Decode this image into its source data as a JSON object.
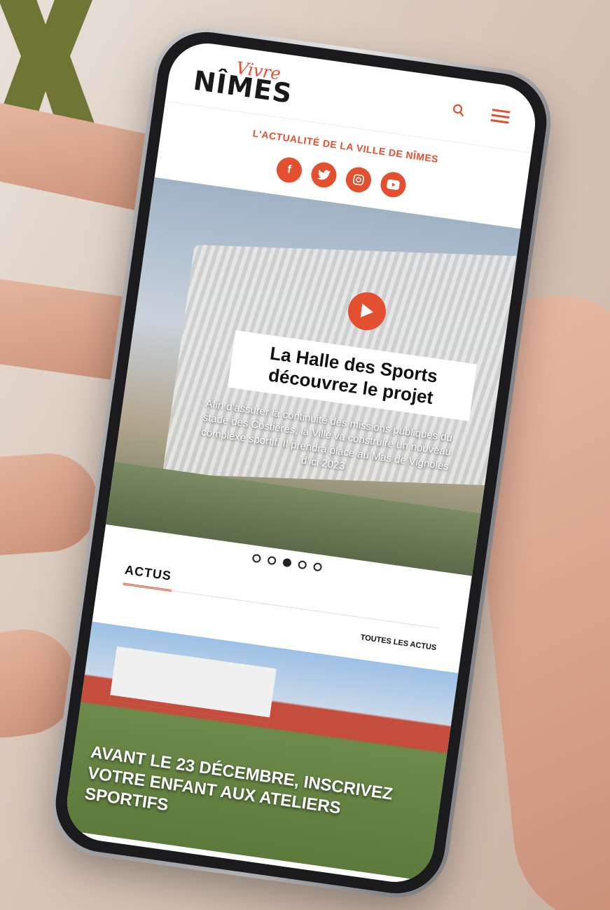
{
  "app": {
    "brand_script": "Vivre",
    "brand_main": "NÎMES",
    "tagline": "L'ACTUALITÉ DE LA VILLE DE NÎMES"
  },
  "header": {
    "icons": [
      "search-icon",
      "menu-icon"
    ]
  },
  "social": [
    "facebook-icon",
    "twitter-icon",
    "instagram-icon",
    "youtube-icon"
  ],
  "hero": {
    "title_line1": "La Halle des Sports",
    "title_line2": "découvrez le projet",
    "text": "Afin d'assurer la continuité des missions publiques du stade des Costières, la Ville va construire un nouveau complexe sportif. Il prendra place au Mas de Vignoles d'ici 2023",
    "slides_total": 5,
    "slide_active": 3
  },
  "actus": {
    "title": "ACTUS",
    "see_all": "TOUTES LES ACTUS",
    "news_title": "AVANT LE 23 DÉCEMBRE, INSCRIVEZ VOTRE ENFANT AUX ATELIERS SPORTIFS"
  },
  "colors": {
    "accent": "#e2502f",
    "logo_x": "#6f7535"
  }
}
